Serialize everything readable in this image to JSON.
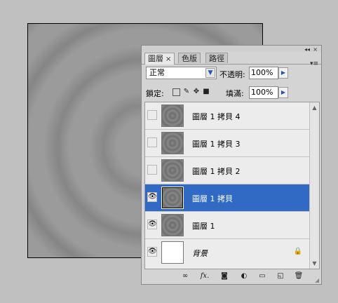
{
  "panel": {
    "tabs": [
      "圖層",
      "色版",
      "路徑"
    ],
    "tab_close": "×",
    "minimize": "◂◂",
    "close": "×",
    "menu": "▾≡"
  },
  "blend": {
    "mode": "正常",
    "arrow": "▼",
    "opacity_label": "不透明:",
    "opacity": "100%",
    "fill_label": "填滿:",
    "fill": "100%",
    "flyout": "▶"
  },
  "lock": {
    "label": "鎖定:",
    "icons": [
      "lock-transparent-icon",
      "lock-pixels-icon",
      "lock-position-icon",
      "lock-all-icon"
    ]
  },
  "layers": [
    {
      "name": "圖層 1 拷貝 4",
      "visible": false,
      "selected": false
    },
    {
      "name": "圖層 1 拷貝 3",
      "visible": false,
      "selected": false
    },
    {
      "name": "圖層 1 拷貝 2",
      "visible": false,
      "selected": false
    },
    {
      "name": "圖層 1 拷貝",
      "visible": true,
      "selected": true
    },
    {
      "name": "圖層 1",
      "visible": true,
      "selected": false
    },
    {
      "name": "背景",
      "visible": true,
      "selected": false,
      "locked": true
    }
  ],
  "bottom_buttons": [
    "link-icon",
    "fx-icon",
    "add-mask-icon",
    "adjustment-layer-icon",
    "new-group-icon",
    "new-layer-icon",
    "trash-icon"
  ],
  "bottom_fx_label": "fx.",
  "colors": {
    "selection": "#316ac5",
    "canvas_gray": "#9b9b9b",
    "app_background": "#c0c0c0"
  }
}
